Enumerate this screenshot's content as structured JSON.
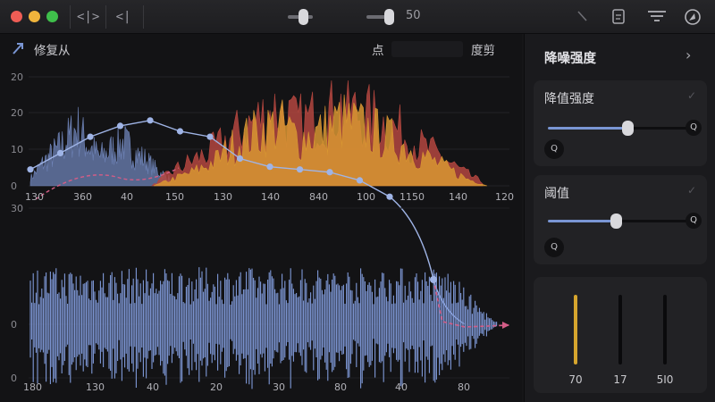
{
  "titlebar": {
    "value_label": "50",
    "icons": [
      "split-left-right-icon",
      "split-center-icon",
      "pen-icon",
      "clipboard-icon",
      "filter-icon",
      "compass-icon"
    ]
  },
  "main": {
    "repair_label": "修复从",
    "point_label": "点",
    "clip_label": "度剪"
  },
  "chart_data": [
    {
      "type": "area",
      "ylim": [
        0,
        20
      ],
      "yticks": [
        "20",
        "20",
        "10",
        "0"
      ],
      "xtick_labels": [
        "130",
        "360",
        "40",
        "150",
        "130",
        "140",
        "840",
        "100",
        "1150",
        "140",
        "120"
      ],
      "series": [
        {
          "values": [
            2,
            6,
            9,
            12,
            16,
            11,
            8,
            10,
            12,
            9,
            7,
            4,
            2
          ]
        },
        {
          "values": [
            0,
            4,
            7,
            10,
            14,
            18,
            21,
            17,
            19,
            22,
            20,
            18,
            15,
            11,
            8,
            4,
            1
          ]
        },
        {
          "values": [
            0,
            2,
            4,
            7,
            12,
            15,
            17,
            13,
            15,
            18,
            16,
            14,
            11,
            8,
            5,
            2,
            0
          ]
        }
      ],
      "curve_points": [
        [
          0,
          3
        ],
        [
          1,
          6
        ],
        [
          2,
          9
        ],
        [
          3,
          11
        ],
        [
          4,
          12
        ],
        [
          5,
          10
        ],
        [
          6,
          9
        ],
        [
          7,
          5
        ],
        [
          8,
          3.5
        ],
        [
          9,
          3
        ],
        [
          10,
          2.5
        ],
        [
          11,
          1
        ],
        [
          12,
          -2
        ]
      ]
    },
    {
      "type": "line",
      "ylim": [
        0,
        30
      ],
      "yticks": [
        "30",
        "0",
        "0"
      ],
      "xtick_labels": [
        "180",
        "130",
        "40",
        "20",
        "30",
        "80",
        "40",
        "80"
      ],
      "series": [
        {
          "name": "waveform"
        }
      ]
    }
  ],
  "panel": {
    "title": "降噪强度",
    "card1": {
      "title": "降值强度",
      "end_icon": "Q",
      "small_icon": "Q",
      "level": 0.57
    },
    "card2": {
      "title": "阈值",
      "end_icon": "Q",
      "small_icon": "Q",
      "level": 0.49
    },
    "meters": [
      {
        "label": "70",
        "level": 1.0,
        "color": "#d6a52e"
      },
      {
        "label": "17",
        "level": 0.0,
        "color": "#6f6f74"
      },
      {
        "label": "5I0",
        "level": 0.0,
        "color": "#6f6f74"
      }
    ]
  },
  "colors": {
    "accent_blue": "#7a96d4",
    "accent_orange": "#d88a3a",
    "accent_red": "#c0504b",
    "accent_pink": "#d35d87"
  }
}
